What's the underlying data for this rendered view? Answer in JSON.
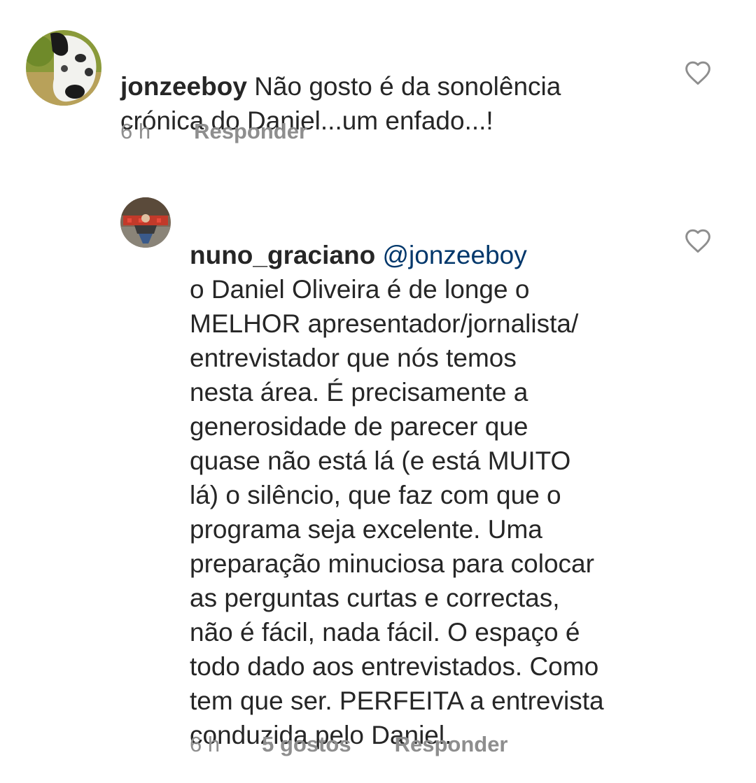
{
  "comments": [
    {
      "username": "jonzeeboy",
      "text": "Não gosto é da sonolência\ncrónica do Daniel...um enfado...!",
      "time": "6 h",
      "reply_label": "Responder",
      "avatar_icon": "dog-avatar",
      "like_icon": "heart-outline-icon"
    },
    {
      "username": "nuno_graciano",
      "mention": "@jonzeeboy",
      "text": "o Daniel Oliveira é de longe o\nMELHOR apresentador/jornalista/\nentrevistador que nós temos\nnesta área. É precisamente a\ngenerosidade de parecer que\nquase não está lá (e está MUITO\nlá) o silêncio, que faz com que o\nprograma seja excelente. Uma\npreparação minuciosa para colocar\nas perguntas curtas e correctas,\nnão é fácil, nada fácil. O espaço é\ntodo dado aos entrevistados. Como\ntem que ser. PERFEITA a entrevista\nconduzida pelo Daniel.",
      "time": "6 h",
      "likes_label": "5 gostos",
      "reply_label": "Responder",
      "avatar_icon": "person-avatar",
      "like_icon": "heart-outline-icon"
    }
  ],
  "colors": {
    "text": "#262626",
    "secondary": "#8e8e8e",
    "mention": "#00376b",
    "background": "#ffffff"
  }
}
